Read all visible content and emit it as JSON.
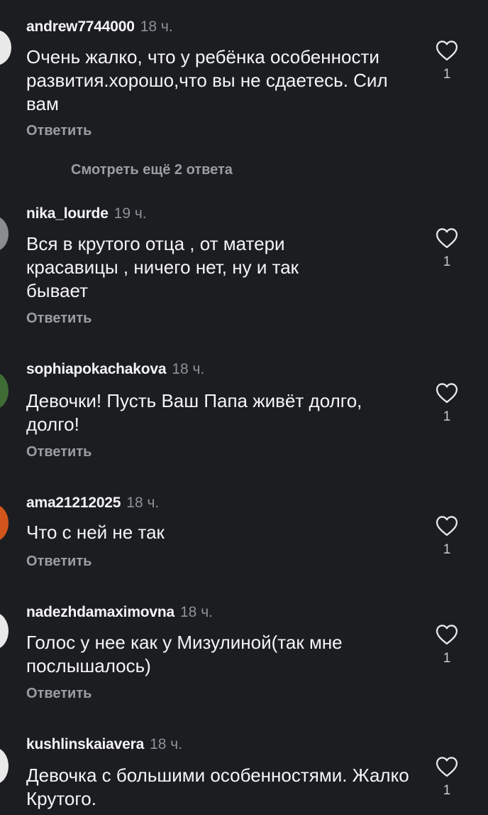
{
  "comments": [
    {
      "username": "andrew7744000",
      "time": "18 ч.",
      "text": "Очень жалко, что у ребёнка особенности развития.хорошо,что вы не сдаетесь. Сил вам",
      "reply_label": "Ответить",
      "likes": "1",
      "view_more": "Смотреть ещё 2 ответа"
    },
    {
      "username": "nika_lourde",
      "time": "19 ч.",
      "text": "Вся в крутого отца , от матери красавицы ,  ничего нет, ну и так бывает",
      "reply_label": "Ответить",
      "likes": "1"
    },
    {
      "username": "sophiapokachakova",
      "time": "18 ч.",
      "text": "Девочки! Пусть Ваш Папа живёт долго, долго!",
      "reply_label": "Ответить",
      "likes": "1"
    },
    {
      "username": "ama21212025",
      "time": "18 ч.",
      "text": "Что с ней не так",
      "reply_label": "Ответить",
      "likes": "1"
    },
    {
      "username": "nadezhdamaximovna",
      "time": "18 ч.",
      "text": "Голос у нее как у Мизулиной(так мне послышалось)",
      "reply_label": "Ответить",
      "likes": "1"
    },
    {
      "username": "kushlinskaiavera",
      "time": "18 ч.",
      "text": "Девочка с большими особенностями. Жалко Крутого.",
      "likes": "1"
    }
  ],
  "colors": {
    "background": "#1b1d21",
    "avatar_1": "#e9e9e9",
    "avatar_2": "#8a8d8f",
    "avatar_3": "#3f6b35",
    "avatar_4": "#d2551b",
    "avatar_5": "#e9e9e9",
    "avatar_6": "#e9e9e9"
  },
  "icons": {
    "like": "heart-outline-icon"
  }
}
